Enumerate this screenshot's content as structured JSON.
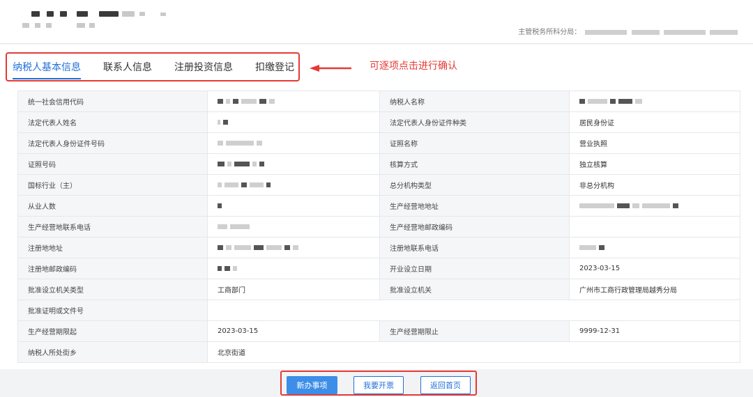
{
  "header": {
    "tax_office_label": "主管税务所科分局："
  },
  "tabs": [
    {
      "label": "纳税人基本信息",
      "active": true
    },
    {
      "label": "联系人信息",
      "active": false
    },
    {
      "label": "注册投资信息",
      "active": false
    },
    {
      "label": "扣缴登记",
      "active": false
    }
  ],
  "annotation": "可逐项点击进行确认",
  "rows": [
    {
      "label1": "统一社会信用代码",
      "value1": "",
      "label2": "纳税人名称",
      "value2": ""
    },
    {
      "label1": "法定代表人姓名",
      "value1": "",
      "label2": "法定代表人身份证件种类",
      "value2": "居民身份证"
    },
    {
      "label1": "法定代表人身份证件号码",
      "value1": "",
      "label2": "证照名称",
      "value2": "营业执照"
    },
    {
      "label1": "证照号码",
      "value1": "",
      "label2": "核算方式",
      "value2": "独立核算"
    },
    {
      "label1": "国标行业（主）",
      "value1": "",
      "label2": "总分机构类型",
      "value2": "非总分机构"
    },
    {
      "label1": "从业人数",
      "value1": "",
      "label2": "生产经营地地址",
      "value2": ""
    },
    {
      "label1": "生产经营地联系电话",
      "value1": "",
      "label2": "生产经营地邮政编码",
      "value2": ""
    },
    {
      "label1": "注册地地址",
      "value1": "",
      "label2": "注册地联系电话",
      "value2": ""
    },
    {
      "label1": "注册地邮政编码",
      "value1": "",
      "label2": "开业设立日期",
      "value2": "2023-03-15"
    },
    {
      "label1": "批准设立机关类型",
      "value1": "工商部门",
      "label2": "批准设立机关",
      "value2": "广州市工商行政管理局越秀分局"
    },
    {
      "label1": "批准证明或文件号",
      "value1": ""
    },
    {
      "label1": "生产经营期限起",
      "value1": "2023-03-15",
      "label2": "生产经营期限止",
      "value2": "9999-12-31"
    },
    {
      "label1": "纳税人所处街乡",
      "value1": "北京街道"
    }
  ],
  "buttons": {
    "new_item": "新办事项",
    "issue_invoice": "我要开票",
    "back_home": "返回首页"
  },
  "colors": {
    "accent": "#1f6fd9",
    "annotation_red": "#e53935",
    "primary_button": "#3d8ee8"
  }
}
